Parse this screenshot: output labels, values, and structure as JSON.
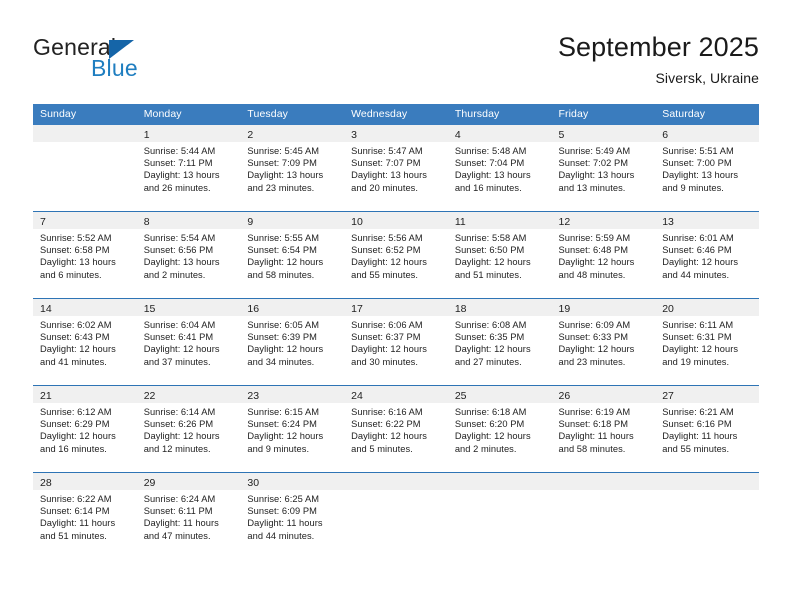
{
  "brand": {
    "name_primary": "General",
    "name_secondary": "Blue",
    "triangle_icon": "triangle-icon",
    "primary_color": "#1565a8",
    "secondary_color": "#1f7ec0"
  },
  "header": {
    "month_title": "September 2025",
    "location": "Siversk, Ukraine"
  },
  "theme": {
    "header_blue": "#3a7cbe",
    "row_divider_blue": "#2e74b5",
    "daynum_band": "#f0f0f0",
    "text": "#222222"
  },
  "day_headers": [
    "Sunday",
    "Monday",
    "Tuesday",
    "Wednesday",
    "Thursday",
    "Friday",
    "Saturday"
  ],
  "weeks": [
    [
      {
        "day": "",
        "sunrise": "",
        "sunset": "",
        "daylight1": "",
        "daylight2": ""
      },
      {
        "day": "1",
        "sunrise": "Sunrise: 5:44 AM",
        "sunset": "Sunset: 7:11 PM",
        "daylight1": "Daylight: 13 hours",
        "daylight2": "and 26 minutes."
      },
      {
        "day": "2",
        "sunrise": "Sunrise: 5:45 AM",
        "sunset": "Sunset: 7:09 PM",
        "daylight1": "Daylight: 13 hours",
        "daylight2": "and 23 minutes."
      },
      {
        "day": "3",
        "sunrise": "Sunrise: 5:47 AM",
        "sunset": "Sunset: 7:07 PM",
        "daylight1": "Daylight: 13 hours",
        "daylight2": "and 20 minutes."
      },
      {
        "day": "4",
        "sunrise": "Sunrise: 5:48 AM",
        "sunset": "Sunset: 7:04 PM",
        "daylight1": "Daylight: 13 hours",
        "daylight2": "and 16 minutes."
      },
      {
        "day": "5",
        "sunrise": "Sunrise: 5:49 AM",
        "sunset": "Sunset: 7:02 PM",
        "daylight1": "Daylight: 13 hours",
        "daylight2": "and 13 minutes."
      },
      {
        "day": "6",
        "sunrise": "Sunrise: 5:51 AM",
        "sunset": "Sunset: 7:00 PM",
        "daylight1": "Daylight: 13 hours",
        "daylight2": "and 9 minutes."
      }
    ],
    [
      {
        "day": "7",
        "sunrise": "Sunrise: 5:52 AM",
        "sunset": "Sunset: 6:58 PM",
        "daylight1": "Daylight: 13 hours",
        "daylight2": "and 6 minutes."
      },
      {
        "day": "8",
        "sunrise": "Sunrise: 5:54 AM",
        "sunset": "Sunset: 6:56 PM",
        "daylight1": "Daylight: 13 hours",
        "daylight2": "and 2 minutes."
      },
      {
        "day": "9",
        "sunrise": "Sunrise: 5:55 AM",
        "sunset": "Sunset: 6:54 PM",
        "daylight1": "Daylight: 12 hours",
        "daylight2": "and 58 minutes."
      },
      {
        "day": "10",
        "sunrise": "Sunrise: 5:56 AM",
        "sunset": "Sunset: 6:52 PM",
        "daylight1": "Daylight: 12 hours",
        "daylight2": "and 55 minutes."
      },
      {
        "day": "11",
        "sunrise": "Sunrise: 5:58 AM",
        "sunset": "Sunset: 6:50 PM",
        "daylight1": "Daylight: 12 hours",
        "daylight2": "and 51 minutes."
      },
      {
        "day": "12",
        "sunrise": "Sunrise: 5:59 AM",
        "sunset": "Sunset: 6:48 PM",
        "daylight1": "Daylight: 12 hours",
        "daylight2": "and 48 minutes."
      },
      {
        "day": "13",
        "sunrise": "Sunrise: 6:01 AM",
        "sunset": "Sunset: 6:46 PM",
        "daylight1": "Daylight: 12 hours",
        "daylight2": "and 44 minutes."
      }
    ],
    [
      {
        "day": "14",
        "sunrise": "Sunrise: 6:02 AM",
        "sunset": "Sunset: 6:43 PM",
        "daylight1": "Daylight: 12 hours",
        "daylight2": "and 41 minutes."
      },
      {
        "day": "15",
        "sunrise": "Sunrise: 6:04 AM",
        "sunset": "Sunset: 6:41 PM",
        "daylight1": "Daylight: 12 hours",
        "daylight2": "and 37 minutes."
      },
      {
        "day": "16",
        "sunrise": "Sunrise: 6:05 AM",
        "sunset": "Sunset: 6:39 PM",
        "daylight1": "Daylight: 12 hours",
        "daylight2": "and 34 minutes."
      },
      {
        "day": "17",
        "sunrise": "Sunrise: 6:06 AM",
        "sunset": "Sunset: 6:37 PM",
        "daylight1": "Daylight: 12 hours",
        "daylight2": "and 30 minutes."
      },
      {
        "day": "18",
        "sunrise": "Sunrise: 6:08 AM",
        "sunset": "Sunset: 6:35 PM",
        "daylight1": "Daylight: 12 hours",
        "daylight2": "and 27 minutes."
      },
      {
        "day": "19",
        "sunrise": "Sunrise: 6:09 AM",
        "sunset": "Sunset: 6:33 PM",
        "daylight1": "Daylight: 12 hours",
        "daylight2": "and 23 minutes."
      },
      {
        "day": "20",
        "sunrise": "Sunrise: 6:11 AM",
        "sunset": "Sunset: 6:31 PM",
        "daylight1": "Daylight: 12 hours",
        "daylight2": "and 19 minutes."
      }
    ],
    [
      {
        "day": "21",
        "sunrise": "Sunrise: 6:12 AM",
        "sunset": "Sunset: 6:29 PM",
        "daylight1": "Daylight: 12 hours",
        "daylight2": "and 16 minutes."
      },
      {
        "day": "22",
        "sunrise": "Sunrise: 6:14 AM",
        "sunset": "Sunset: 6:26 PM",
        "daylight1": "Daylight: 12 hours",
        "daylight2": "and 12 minutes."
      },
      {
        "day": "23",
        "sunrise": "Sunrise: 6:15 AM",
        "sunset": "Sunset: 6:24 PM",
        "daylight1": "Daylight: 12 hours",
        "daylight2": "and 9 minutes."
      },
      {
        "day": "24",
        "sunrise": "Sunrise: 6:16 AM",
        "sunset": "Sunset: 6:22 PM",
        "daylight1": "Daylight: 12 hours",
        "daylight2": "and 5 minutes."
      },
      {
        "day": "25",
        "sunrise": "Sunrise: 6:18 AM",
        "sunset": "Sunset: 6:20 PM",
        "daylight1": "Daylight: 12 hours",
        "daylight2": "and 2 minutes."
      },
      {
        "day": "26",
        "sunrise": "Sunrise: 6:19 AM",
        "sunset": "Sunset: 6:18 PM",
        "daylight1": "Daylight: 11 hours",
        "daylight2": "and 58 minutes."
      },
      {
        "day": "27",
        "sunrise": "Sunrise: 6:21 AM",
        "sunset": "Sunset: 6:16 PM",
        "daylight1": "Daylight: 11 hours",
        "daylight2": "and 55 minutes."
      }
    ],
    [
      {
        "day": "28",
        "sunrise": "Sunrise: 6:22 AM",
        "sunset": "Sunset: 6:14 PM",
        "daylight1": "Daylight: 11 hours",
        "daylight2": "and 51 minutes."
      },
      {
        "day": "29",
        "sunrise": "Sunrise: 6:24 AM",
        "sunset": "Sunset: 6:11 PM",
        "daylight1": "Daylight: 11 hours",
        "daylight2": "and 47 minutes."
      },
      {
        "day": "30",
        "sunrise": "Sunrise: 6:25 AM",
        "sunset": "Sunset: 6:09 PM",
        "daylight1": "Daylight: 11 hours",
        "daylight2": "and 44 minutes."
      },
      {
        "day": "",
        "sunrise": "",
        "sunset": "",
        "daylight1": "",
        "daylight2": ""
      },
      {
        "day": "",
        "sunrise": "",
        "sunset": "",
        "daylight1": "",
        "daylight2": ""
      },
      {
        "day": "",
        "sunrise": "",
        "sunset": "",
        "daylight1": "",
        "daylight2": ""
      },
      {
        "day": "",
        "sunrise": "",
        "sunset": "",
        "daylight1": "",
        "daylight2": ""
      }
    ]
  ]
}
